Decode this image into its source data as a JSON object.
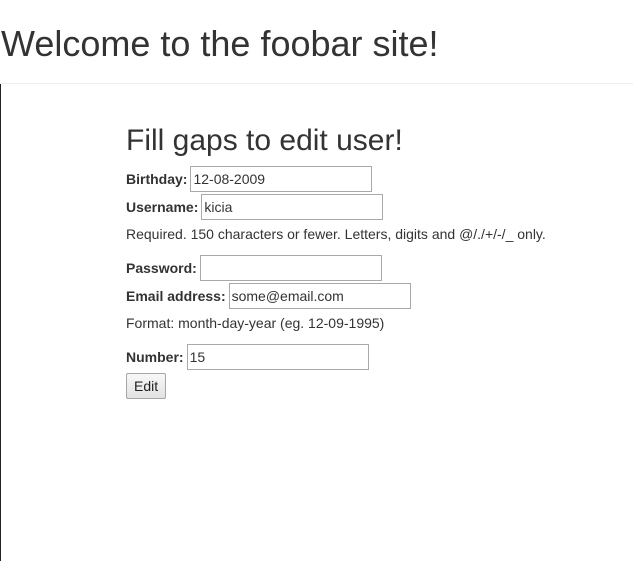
{
  "header": {
    "title": "Welcome to the foobar site!"
  },
  "form": {
    "heading": "Fill gaps to edit user!",
    "birthday": {
      "label": "Birthday:",
      "value": "12-08-2009"
    },
    "username": {
      "label": "Username:",
      "value": "kicia",
      "help": "Required. 150 characters or fewer. Letters, digits and @/./+/-/_ only."
    },
    "password": {
      "label": "Password:",
      "value": ""
    },
    "email": {
      "label": "Email address:",
      "value": "some@email.com",
      "help": "Format: month-day-year (eg. 12-09-1995)"
    },
    "number": {
      "label": "Number:",
      "value": "15"
    },
    "submit_label": "Edit"
  }
}
